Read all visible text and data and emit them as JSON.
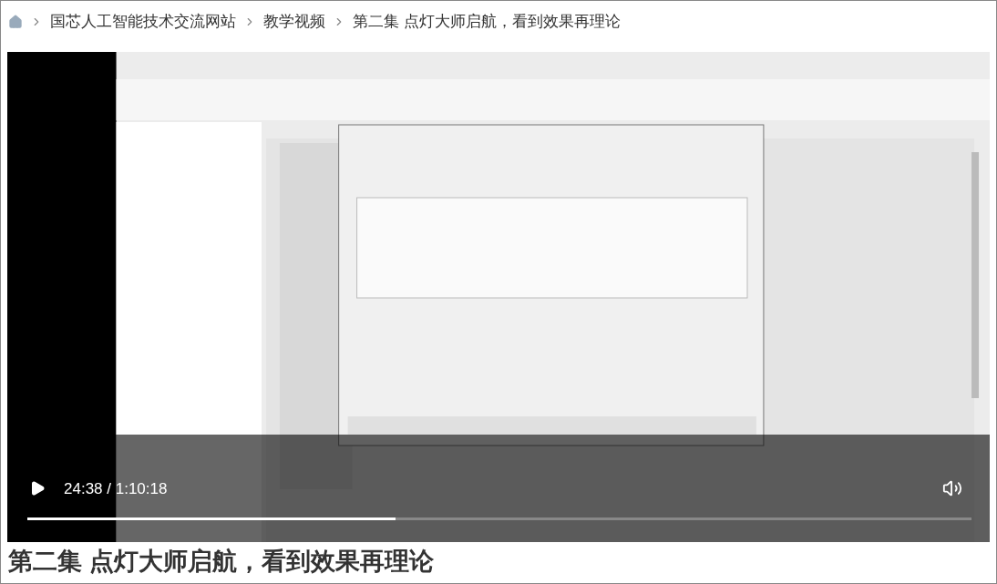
{
  "breadcrumb": [
    {
      "label": "国芯人工智能技术交流网站"
    },
    {
      "label": "教学视频"
    },
    {
      "label": "第二集 点灯大师启航，看到效果再理论"
    }
  ],
  "video": {
    "kind": "picture",
    "time": "24:38 / 1:10:18",
    "progress": {
      "level": 0.39
    }
  },
  "title": "第二集 点灯大师启航，看到效果再理论"
}
